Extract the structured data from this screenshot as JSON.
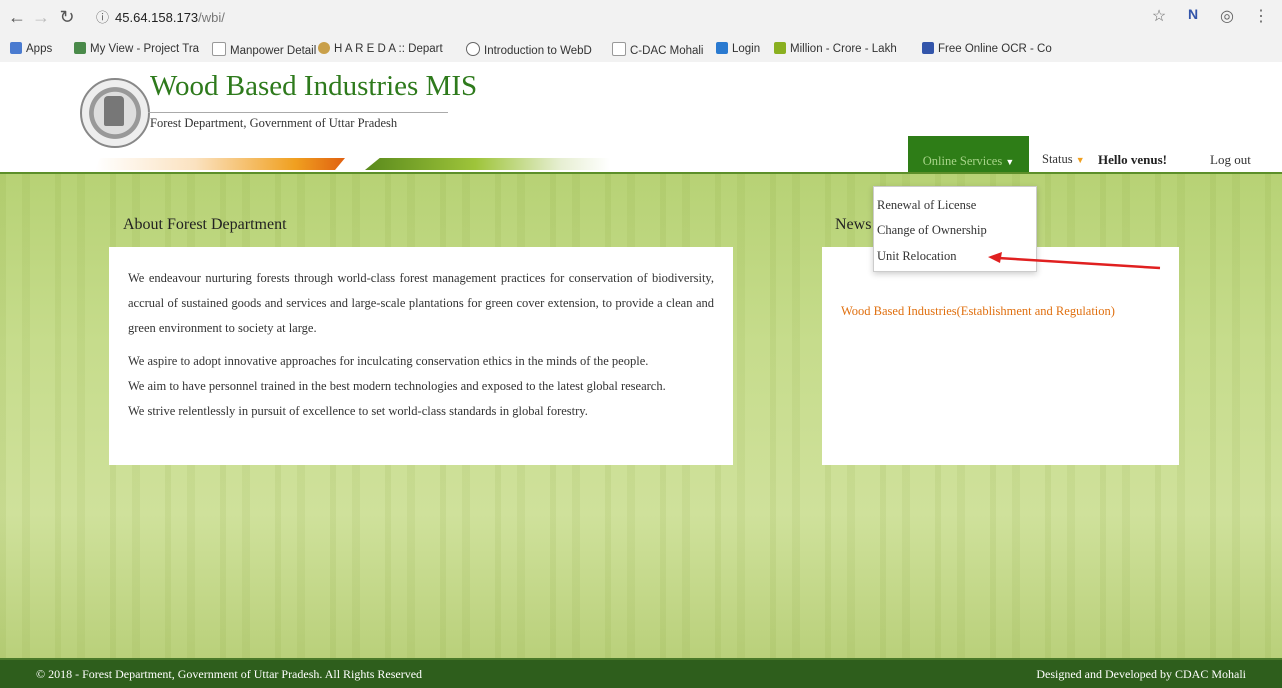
{
  "browser": {
    "url_host": "45.64.158.173",
    "url_path": "/wbi/",
    "bookmarks": [
      {
        "label": "Apps",
        "icon": "apps-grid-icon",
        "color": "#4a7bd0"
      },
      {
        "label": "My View - Project Tra",
        "icon": "cdac-icon",
        "color": "#4a8a4a"
      },
      {
        "label": "Manpower Detail",
        "icon": "page-icon",
        "color": "#999999"
      },
      {
        "label": "H A R E D A :: Depart",
        "icon": "hareda-icon",
        "color": "#c9a04a"
      },
      {
        "label": "Introduction to WebD",
        "icon": "webd-icon",
        "color": "#666666"
      },
      {
        "label": "C-DAC Mohali",
        "icon": "page-icon",
        "color": "#999999"
      },
      {
        "label": "Login",
        "icon": "login-icon",
        "color": "#2a7ad0"
      },
      {
        "label": "Million - Crore - Lakh",
        "icon": "nc-icon",
        "color": "#8ab020"
      },
      {
        "label": "Free Online OCR - Co",
        "icon": "ocr-icon",
        "color": "#3355aa"
      }
    ]
  },
  "header": {
    "title": "Wood Based Industries MIS",
    "subtitle": "Forest Department, Government of Uttar Pradesh"
  },
  "nav": {
    "online_services": "Online Services",
    "status": "Status",
    "hello": "Hello venus!",
    "logout": "Log out"
  },
  "dropdown": {
    "items": [
      "Renewal of License",
      "Change of Ownership",
      "Unit Relocation"
    ]
  },
  "about": {
    "title": "About Forest Department",
    "paragraph": "We endeavour nurturing forests through world-class forest management practices for conservation of biodiversity, accrual of sustained goods and services and large-scale plantations for green cover extension, to provide a clean and green environment to society at large.",
    "lines": [
      "We aspire to adopt innovative approaches for inculcating conservation ethics in the minds of the people.",
      "We aim to have personnel trained in the best modern technologies and exposed to the latest global research.",
      "We strive relentlessly in pursuit of excellence to set world-class standards in global forestry."
    ]
  },
  "news": {
    "title": "News",
    "link": "Wood Based Industries(Establishment and Regulation)"
  },
  "footer": {
    "left": "© 2018 - Forest Department, Government of Uttar Pradesh.  All Rights Reserved",
    "right": "Designed and Developed by CDAC Mohali"
  }
}
